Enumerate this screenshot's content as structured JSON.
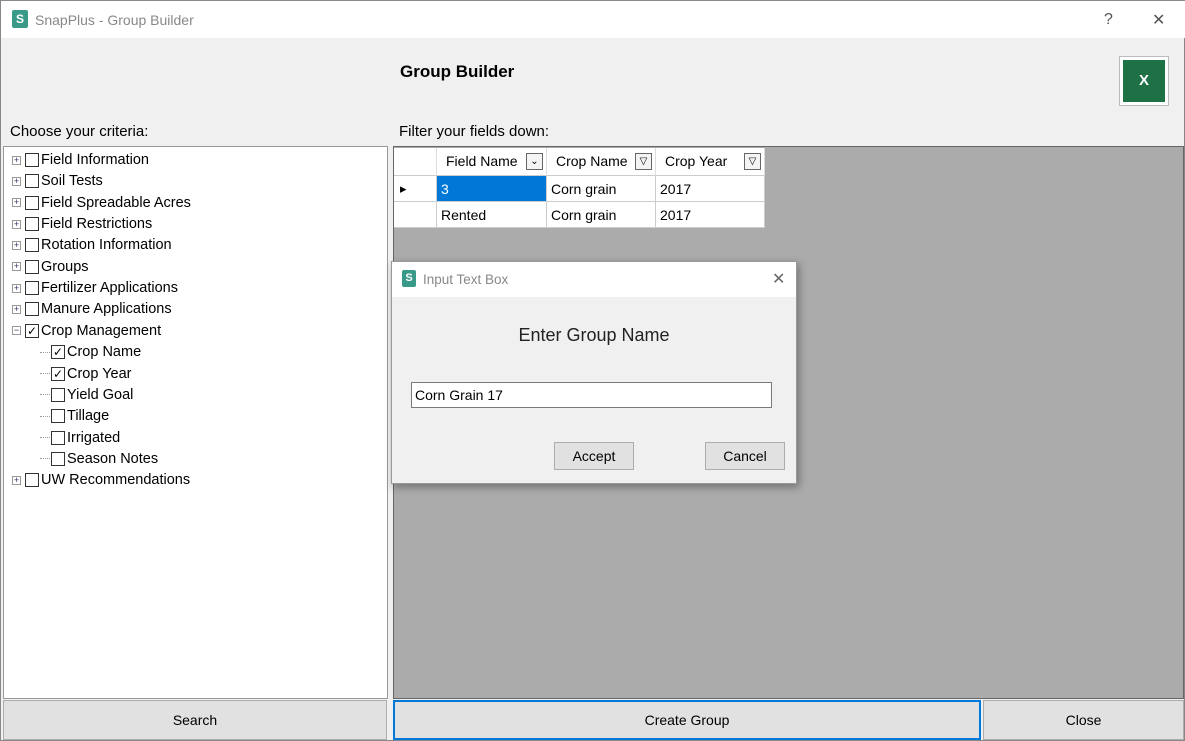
{
  "window": {
    "title": "SnapPlus - Group Builder",
    "help": "?",
    "close": "✕"
  },
  "header": {
    "title": "Group Builder",
    "export_icon": "excel-icon",
    "export_label": "X"
  },
  "criteria": {
    "label": "Choose your criteria:",
    "items": [
      {
        "label": "Field Information",
        "checked": false,
        "expanded": false
      },
      {
        "label": "Soil Tests",
        "checked": false,
        "expanded": false
      },
      {
        "label": "Field Spreadable Acres",
        "checked": false,
        "expanded": false
      },
      {
        "label": "Field Restrictions",
        "checked": false,
        "expanded": false
      },
      {
        "label": "Rotation Information",
        "checked": false,
        "expanded": false
      },
      {
        "label": "Groups",
        "checked": false,
        "expanded": false
      },
      {
        "label": "Fertilizer Applications",
        "checked": false,
        "expanded": false
      },
      {
        "label": "Manure Applications",
        "checked": false,
        "expanded": false
      },
      {
        "label": "Crop Management",
        "checked": true,
        "expanded": true,
        "children": [
          {
            "label": "Crop Name",
            "checked": true
          },
          {
            "label": "Crop Year",
            "checked": true
          },
          {
            "label": "Yield Goal",
            "checked": false
          },
          {
            "label": "Tillage",
            "checked": false
          },
          {
            "label": "Irrigated",
            "checked": false
          },
          {
            "label": "Season Notes",
            "checked": false
          }
        ]
      },
      {
        "label": "UW Recommendations",
        "checked": false,
        "expanded": false
      }
    ]
  },
  "filter": {
    "label": "Filter your fields down:",
    "columns": [
      "Field Name",
      "Crop Name",
      "Crop Year"
    ],
    "rows": [
      [
        "3",
        "Corn grain",
        "2017"
      ],
      [
        "Rented",
        "Corn grain",
        "2017"
      ]
    ],
    "selected_color": "#0078d7"
  },
  "dialog": {
    "title": "Input Text Box",
    "close": "✕",
    "prompt": "Enter Group Name",
    "value": "Corn Grain 17",
    "accept": "Accept",
    "cancel": "Cancel"
  },
  "footer": {
    "search": "Search",
    "create": "Create Group",
    "close": "Close"
  }
}
